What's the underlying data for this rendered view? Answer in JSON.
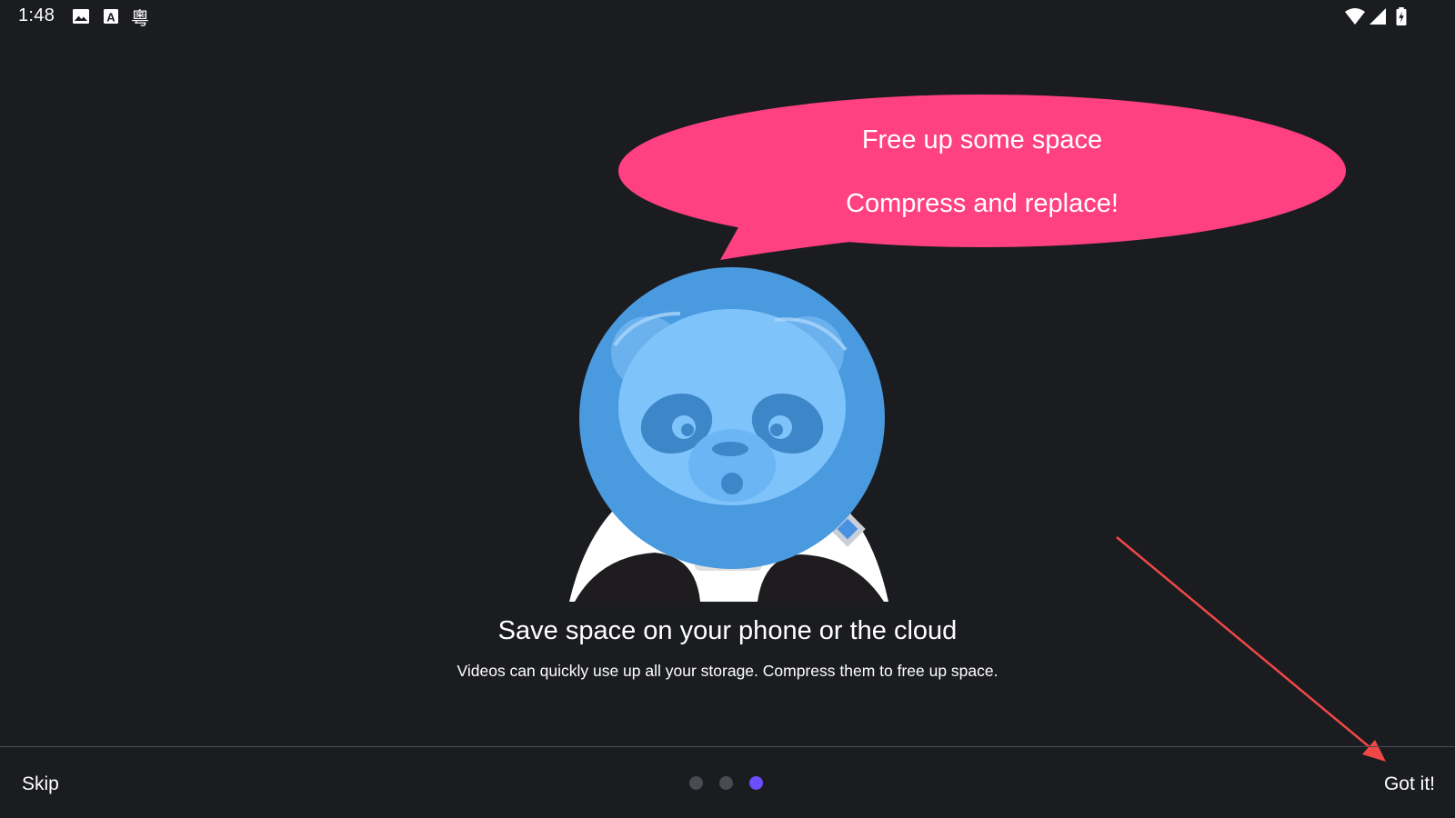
{
  "status_bar": {
    "time": "1:48",
    "left_icons": [
      "image-icon",
      "text-a-icon",
      "cantonese-input-icon"
    ],
    "cantonese_glyph": "粵",
    "right_icons": [
      "wifi-icon",
      "signal-icon",
      "battery-charging-icon"
    ]
  },
  "bubble": {
    "line1": "Free up some space",
    "line2": "Compress and replace!",
    "color": "#ff4081"
  },
  "onboarding": {
    "title": "Save space on your phone or the cloud",
    "subtitle": "Videos can quickly use up all your storage. Compress them to free up space."
  },
  "footer": {
    "skip_label": "Skip",
    "done_label": "Got it!",
    "page_indicator": {
      "total": 3,
      "active_index": 2
    },
    "dot_inactive_color": "#4a4b52",
    "dot_active_color": "#6c4dff"
  },
  "colors": {
    "background": "#1b1c20",
    "helmet": "#4a9ae0",
    "face": "#7ec4fb",
    "arrow": "#f04848"
  }
}
